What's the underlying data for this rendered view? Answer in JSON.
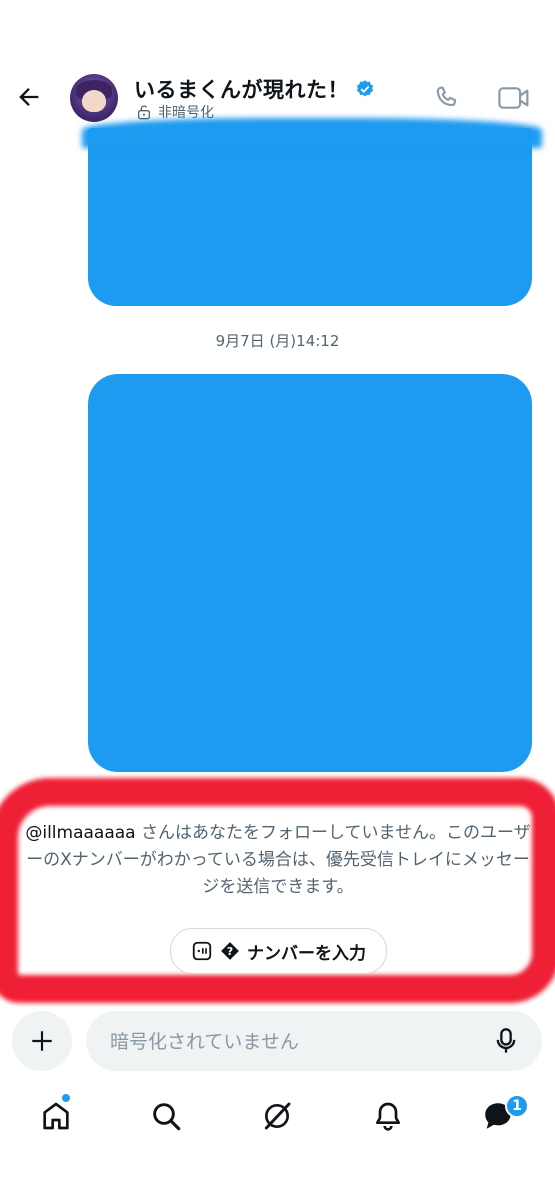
{
  "header": {
    "back_icon": "arrow-left-icon",
    "title": "いるまくんが現れた！",
    "verified_icon": "verified-badge-icon",
    "encryption_status": "非暗号化",
    "lock_icon": "unlock-icon",
    "call_icon": "phone-icon",
    "video_icon": "video-camera-icon"
  },
  "messages": {
    "timestamp": "9月7日 (月)14:12",
    "bubble_color": "#1d9bf0"
  },
  "notice": {
    "handle": "@illmaaaaaa",
    "text": "さんはあなたをフォローしていません。このユーザーのXナンバーがわかっている場合は、優先受信トレイにメッセージを送信できます。",
    "button_label": "ナンバーを入力",
    "button_icon": "number-input-icon",
    "highlight_color": "#ef1f35"
  },
  "composer": {
    "plus_icon": "plus-icon",
    "placeholder": "暗号化されていません",
    "mic_icon": "microphone-icon"
  },
  "nav": {
    "items": [
      "home-icon",
      "search-icon",
      "grok-icon",
      "notifications-icon",
      "messages-icon"
    ],
    "messages_badge": "1"
  },
  "colors": {
    "accent": "#1d9bf0",
    "text": "#0f1419",
    "muted": "#536471"
  }
}
